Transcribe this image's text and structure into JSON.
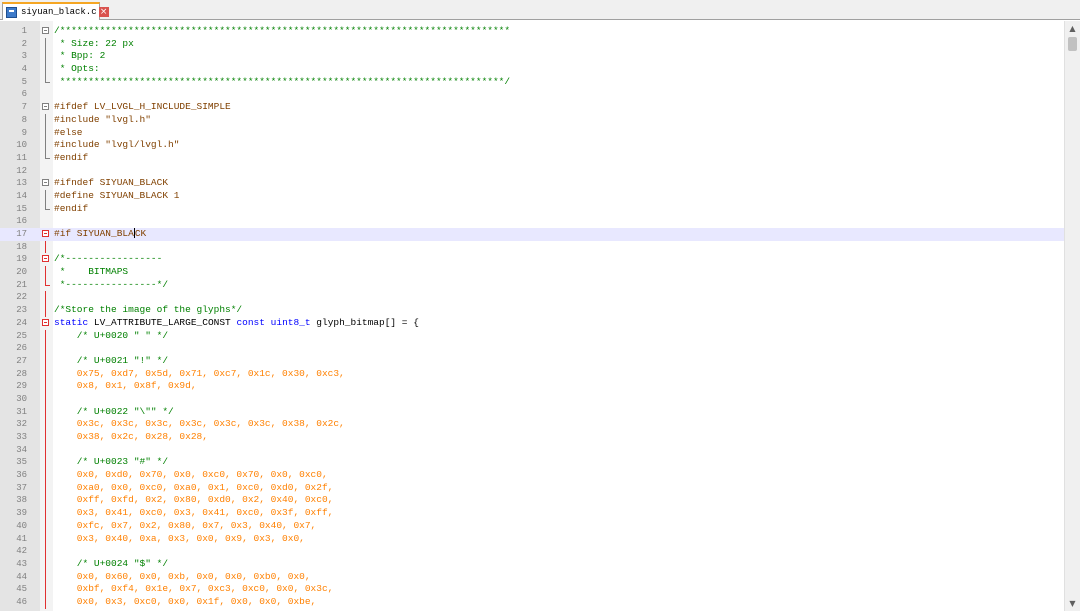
{
  "tab": {
    "label": "siyuan_black.c",
    "close_icon": "×"
  },
  "scrollbar": {
    "up_icon": "▲",
    "down_icon": "▼"
  },
  "colors": {
    "comment": "#008000",
    "preprocessor": "#804000",
    "number": "#ff8000",
    "keyword": "#0000ff",
    "string": "#808080",
    "current_line": "#e8e8ff"
  },
  "current_line": 17,
  "lines": [
    {
      "n": "1",
      "segs": [
        [
          "cmt",
          "/*******************************************************************************"
        ]
      ]
    },
    {
      "n": "2",
      "segs": [
        [
          "cmt",
          " * Size: 22 px"
        ]
      ]
    },
    {
      "n": "3",
      "segs": [
        [
          "cmt",
          " * Bpp: 2"
        ]
      ]
    },
    {
      "n": "4",
      "segs": [
        [
          "cmt",
          " * Opts:"
        ]
      ]
    },
    {
      "n": "5",
      "segs": [
        [
          "cmt",
          " ******************************************************************************/"
        ]
      ]
    },
    {
      "n": "6",
      "segs": []
    },
    {
      "n": "7",
      "segs": [
        [
          "pp",
          "#ifdef LV_LVGL_H_INCLUDE_SIMPLE"
        ]
      ]
    },
    {
      "n": "8",
      "segs": [
        [
          "pp",
          "#include \"lvgl.h\""
        ]
      ]
    },
    {
      "n": "9",
      "segs": [
        [
          "pp",
          "#else"
        ]
      ]
    },
    {
      "n": "10",
      "segs": [
        [
          "pp",
          "#include \"lvgl/lvgl.h\""
        ]
      ]
    },
    {
      "n": "11",
      "segs": [
        [
          "pp",
          "#endif"
        ]
      ]
    },
    {
      "n": "12",
      "segs": []
    },
    {
      "n": "13",
      "segs": [
        [
          "pp",
          "#ifndef SIYUAN_BLACK"
        ]
      ]
    },
    {
      "n": "14",
      "segs": [
        [
          "pp",
          "#define SIYUAN_BLACK 1"
        ]
      ]
    },
    {
      "n": "15",
      "segs": [
        [
          "pp",
          "#endif"
        ]
      ]
    },
    {
      "n": "16",
      "segs": []
    },
    {
      "n": "17",
      "segs": [
        [
          "pp",
          "#if SIYUAN_BLA"
        ],
        [
          "caret",
          ""
        ],
        [
          "pp",
          "CK"
        ]
      ]
    },
    {
      "n": "18",
      "segs": []
    },
    {
      "n": "19",
      "segs": [
        [
          "cmt",
          "/*-----------------"
        ]
      ]
    },
    {
      "n": "20",
      "segs": [
        [
          "cmt",
          " *    BITMAPS"
        ]
      ]
    },
    {
      "n": "21",
      "segs": [
        [
          "cmt",
          " *----------------*/"
        ]
      ]
    },
    {
      "n": "22",
      "segs": []
    },
    {
      "n": "23",
      "segs": [
        [
          "cmt",
          "/*Store the image of the glyphs*/"
        ]
      ]
    },
    {
      "n": "24",
      "segs": [
        [
          "kw",
          "static"
        ],
        [
          "txt",
          " LV_ATTRIBUTE_LARGE_CONST "
        ],
        [
          "kw",
          "const"
        ],
        [
          "txt",
          " "
        ],
        [
          "kw",
          "uint8_t"
        ],
        [
          "txt",
          " glyph_bitmap[] = {"
        ]
      ]
    },
    {
      "n": "25",
      "segs": [
        [
          "cmt",
          "    /* U+0020 \" \" */"
        ]
      ]
    },
    {
      "n": "26",
      "segs": []
    },
    {
      "n": "27",
      "segs": [
        [
          "cmt",
          "    /* U+0021 \"!\" */"
        ]
      ]
    },
    {
      "n": "28",
      "segs": [
        [
          "num",
          "    0x75, 0xd7, 0x5d, 0x71, 0xc7, 0x1c, 0x30, 0xc3,"
        ]
      ]
    },
    {
      "n": "29",
      "segs": [
        [
          "num",
          "    0x8, 0x1, 0x8f, 0x9d,"
        ]
      ]
    },
    {
      "n": "30",
      "segs": []
    },
    {
      "n": "31",
      "segs": [
        [
          "cmt",
          "    /* U+0022 \"\\\"\" */"
        ]
      ]
    },
    {
      "n": "32",
      "segs": [
        [
          "num",
          "    0x3c, 0x3c, 0x3c, 0x3c, 0x3c, 0x3c, 0x38, 0x2c,"
        ]
      ]
    },
    {
      "n": "33",
      "segs": [
        [
          "num",
          "    0x38, 0x2c, 0x28, 0x28,"
        ]
      ]
    },
    {
      "n": "34",
      "segs": []
    },
    {
      "n": "35",
      "segs": [
        [
          "cmt",
          "    /* U+0023 \"#\" */"
        ]
      ]
    },
    {
      "n": "36",
      "segs": [
        [
          "num",
          "    0x0, 0xd0, 0x70, 0x0, 0xc0, 0x70, 0x0, 0xc0,"
        ]
      ]
    },
    {
      "n": "37",
      "segs": [
        [
          "num",
          "    0xa0, 0x0, 0xc0, 0xa0, 0x1, 0xc0, 0xd0, 0x2f,"
        ]
      ]
    },
    {
      "n": "38",
      "segs": [
        [
          "num",
          "    0xff, 0xfd, 0x2, 0x80, 0xd0, 0x2, 0x40, 0xc0,"
        ]
      ]
    },
    {
      "n": "39",
      "segs": [
        [
          "num",
          "    0x3, 0x41, 0xc0, 0x3, 0x41, 0xc0, 0x3f, 0xff,"
        ]
      ]
    },
    {
      "n": "40",
      "segs": [
        [
          "num",
          "    0xfc, 0x7, 0x2, 0x80, 0x7, 0x3, 0x40, 0x7,"
        ]
      ]
    },
    {
      "n": "41",
      "segs": [
        [
          "num",
          "    0x3, 0x40, 0xa, 0x3, 0x0, 0x9, 0x3, 0x0,"
        ]
      ]
    },
    {
      "n": "42",
      "segs": []
    },
    {
      "n": "43",
      "segs": [
        [
          "cmt",
          "    /* U+0024 \"$\" */"
        ]
      ]
    },
    {
      "n": "44",
      "segs": [
        [
          "num",
          "    0x0, 0x60, 0x0, 0xb, 0x0, 0x0, 0xb0, 0x0,"
        ]
      ]
    },
    {
      "n": "45",
      "segs": [
        [
          "num",
          "    0xbf, 0xf4, 0x1e, 0x7, 0xc3, 0xc0, 0x0, 0x3c,"
        ]
      ]
    },
    {
      "n": "46",
      "segs": [
        [
          "num",
          "    0x0, 0x3, 0xc0, 0x0, 0x1f, 0x0, 0x0, 0xbe,"
        ]
      ]
    }
  ]
}
